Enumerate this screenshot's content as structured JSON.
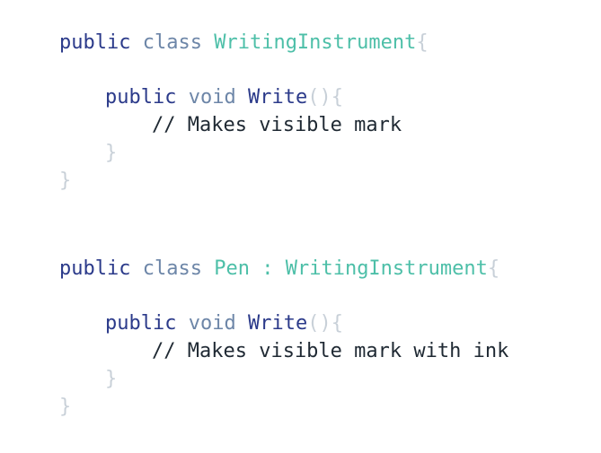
{
  "blocks": [
    {
      "keyword_public": "public",
      "keyword_class": "class",
      "class_name": "WritingInstrument",
      "extends_sep": "",
      "base_class": "",
      "open_brace": "{",
      "method": {
        "keyword_public": "public",
        "keyword_void": "void",
        "name": "Write",
        "parens": "()",
        "open_brace": "{",
        "comment": "// Makes visible mark",
        "close_brace": "}"
      },
      "close_brace": "}"
    },
    {
      "keyword_public": "public",
      "keyword_class": "class",
      "class_name": "Pen",
      "extends_sep": " : ",
      "base_class": "WritingInstrument",
      "open_brace": "{",
      "method": {
        "keyword_public": "public",
        "keyword_void": "void",
        "name": "Write",
        "parens": "()",
        "open_brace": "{",
        "comment": "// Makes visible mark with ink",
        "close_brace": "}"
      },
      "close_brace": "}"
    }
  ]
}
